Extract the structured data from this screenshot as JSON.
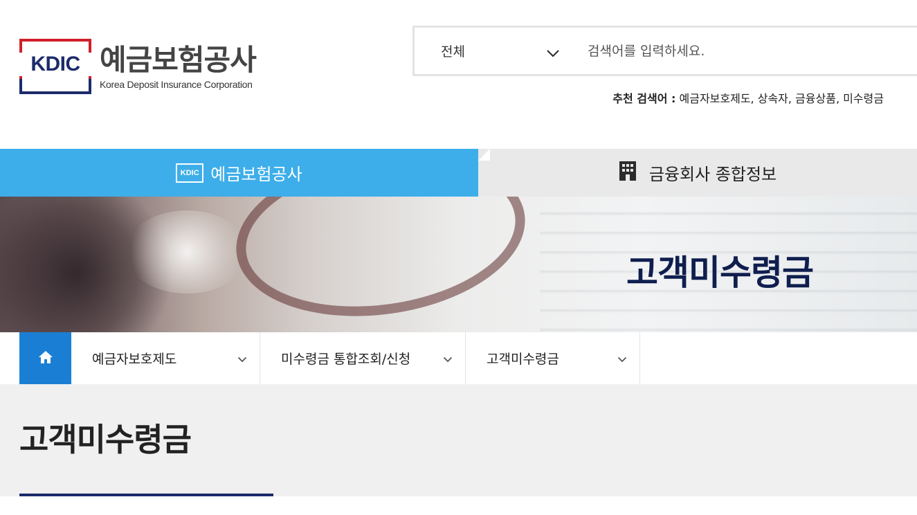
{
  "header": {
    "logo_abbr": "KDIC",
    "logo_name_ko": "예금보험공사",
    "logo_name_en": "Korea Deposit Insurance Corporation",
    "brand_colors": {
      "red": "#d0202a",
      "navy": "#1c2b6b"
    }
  },
  "search": {
    "scope_selected": "전체",
    "scope_icon": "chevron-down-icon",
    "placeholder": "검색어를 입력하세요.",
    "value": ""
  },
  "recommend": {
    "label": "추천 검색어 :",
    "terms": "예금자보호제도, 상속자, 금융상품, 미수령금"
  },
  "site_tabs": {
    "active": {
      "badge": "KDIC",
      "label": "예금보험공사",
      "color": "#3daee9"
    },
    "inactive": {
      "icon": "building-icon",
      "label": "금융회사 종합정보",
      "color": "#e9e9e9"
    }
  },
  "banner": {
    "title": "고객미수령금"
  },
  "breadcrumb": {
    "home_icon": "home-icon",
    "home_color": "#1a7fd4",
    "items": [
      {
        "label": "예금자보호제도"
      },
      {
        "label": "미수령금 통합조회/신청"
      },
      {
        "label": "고객미수령금"
      }
    ]
  },
  "page": {
    "title": "고객미수령금"
  }
}
